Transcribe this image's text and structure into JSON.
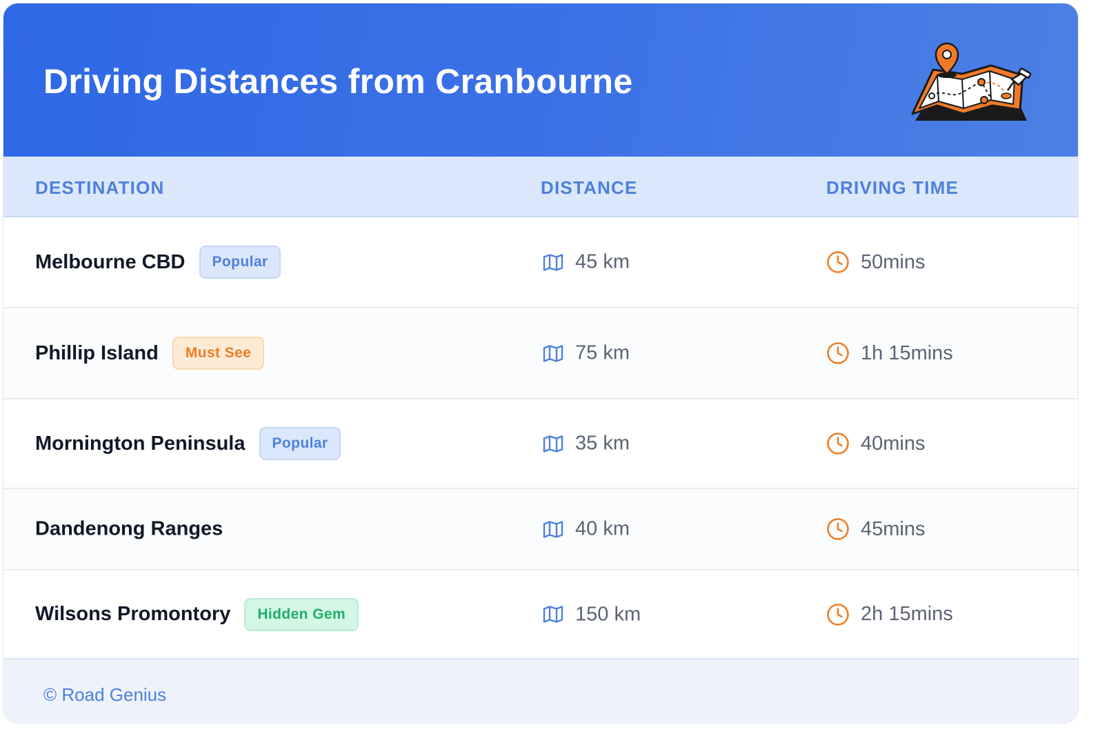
{
  "header": {
    "title": "Driving Distances from Cranbourne"
  },
  "table": {
    "columns": [
      "DESTINATION",
      "DISTANCE",
      "DRIVING TIME"
    ],
    "rows": [
      {
        "destination": "Melbourne CBD",
        "badge": "Popular",
        "badge_style": "blue",
        "distance": "45 km",
        "time": "50mins"
      },
      {
        "destination": "Phillip Island",
        "badge": "Must See",
        "badge_style": "orange",
        "distance": "75 km",
        "time": "1h 15mins"
      },
      {
        "destination": "Mornington Peninsula",
        "badge": "Popular",
        "badge_style": "blue",
        "distance": "35 km",
        "time": "40mins"
      },
      {
        "destination": "Dandenong Ranges",
        "badge": "",
        "badge_style": "",
        "distance": "40 km",
        "time": "45mins"
      },
      {
        "destination": "Wilsons Promontory",
        "badge": "Hidden Gem",
        "badge_style": "green",
        "distance": "150 km",
        "time": "2h 15mins"
      }
    ]
  },
  "icons": {
    "distance_icon": "map-icon",
    "time_icon": "clock-icon",
    "header_illustration": "folded-map-with-pins"
  },
  "footer": {
    "text": "© Road Genius"
  },
  "colors": {
    "header_gradient_start": "#2f68e6",
    "header_gradient_end": "#4c80e4",
    "accent_blue": "#4d7fdd",
    "accent_orange": "#ef7d22",
    "accent_green": "#1fae69"
  }
}
